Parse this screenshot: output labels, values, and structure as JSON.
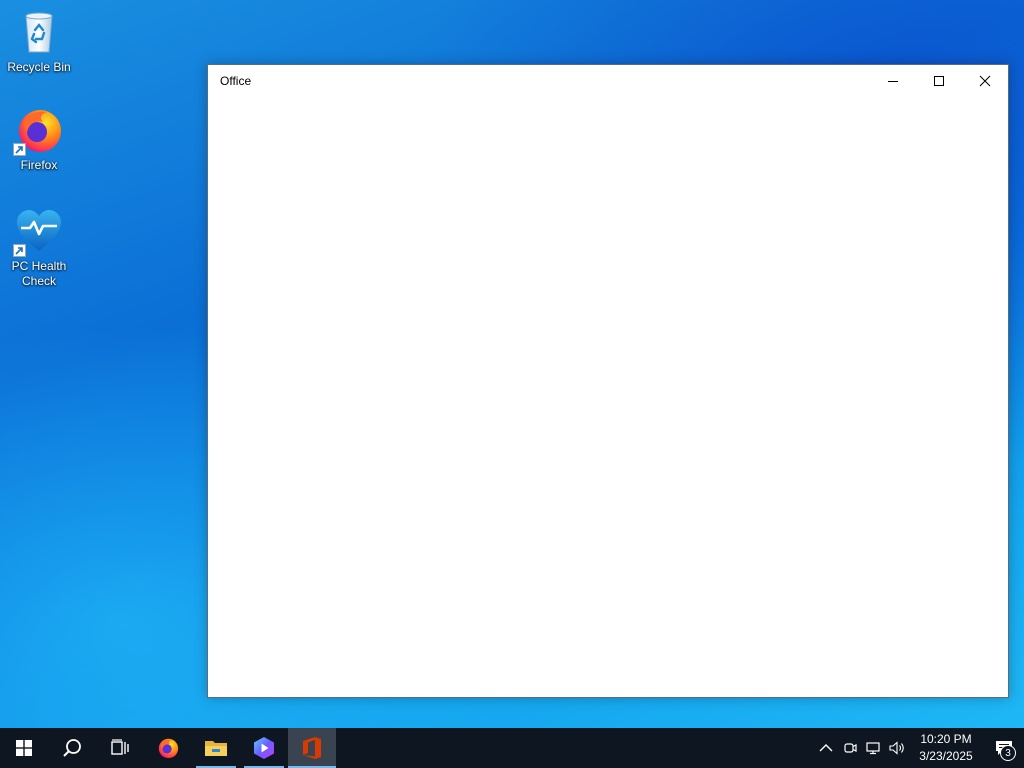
{
  "desktop": {
    "icons": [
      {
        "label": "Recycle Bin",
        "icon": "recycle-bin-icon"
      },
      {
        "label": "Firefox",
        "icon": "firefox-icon"
      },
      {
        "label": "PC Health\nCheck",
        "icon": "pc-health-check-icon"
      }
    ]
  },
  "window": {
    "title": "Office",
    "buttons": {
      "minimize": "minimize-icon",
      "maximize": "maximize-icon",
      "close": "close-icon"
    }
  },
  "taskbar": {
    "apps": [
      {
        "name": "start",
        "icon": "windows-logo-icon"
      },
      {
        "name": "search",
        "icon": "search-icon"
      },
      {
        "name": "task-view",
        "icon": "task-view-icon"
      },
      {
        "name": "firefox",
        "icon": "firefox-icon"
      },
      {
        "name": "file-explorer",
        "icon": "folder-icon"
      },
      {
        "name": "media-app",
        "icon": "play-icon"
      },
      {
        "name": "office",
        "icon": "office-icon"
      }
    ],
    "tray": {
      "time": "10:20 PM",
      "date": "3/23/2025",
      "notification_count": "3"
    }
  },
  "colors": {
    "taskbar": "#0e1621",
    "accent": "#76b9ed",
    "office_red": "#d83b01"
  }
}
